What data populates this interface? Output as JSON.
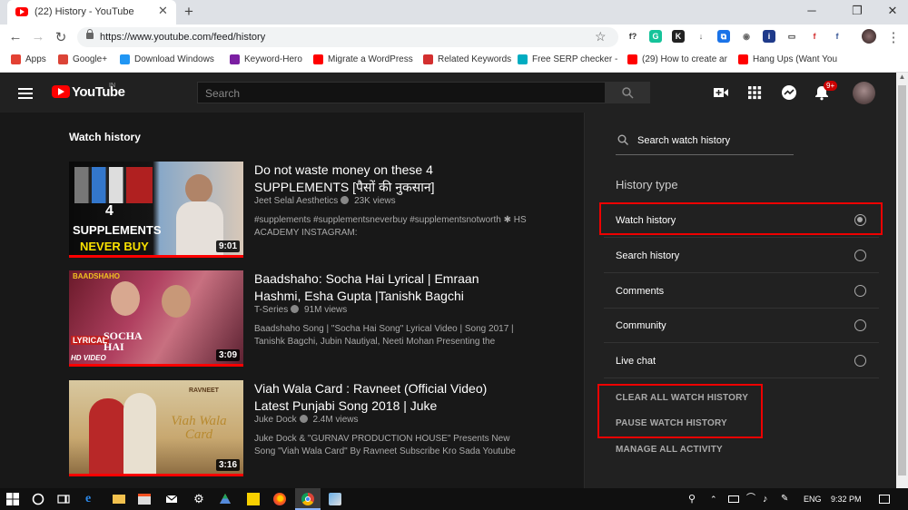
{
  "browser": {
    "tab_title": "(22) History - YouTube",
    "tab_close": "✕",
    "new_tab": "+",
    "window_minimize": "─",
    "window_restore": "❐",
    "window_close": "✕",
    "url": "https://www.youtube.com/feed/history",
    "nav_back": "←",
    "nav_forward": "→",
    "nav_reload": "↻",
    "star": "☆",
    "menu_dots": "⋮"
  },
  "extensions": [
    {
      "label": "f?",
      "color": "#ffffff",
      "text_color": "#333333"
    },
    {
      "label": "G",
      "color": "#15c39a",
      "text_color": "#ffffff"
    },
    {
      "label": "K",
      "color": "#222222",
      "text_color": "#ffffff"
    },
    {
      "label": "↓",
      "color": "#ffffff",
      "text_color": "#555555"
    },
    {
      "label": "⧉",
      "color": "#1a73e8",
      "text_color": "#ffffff"
    },
    {
      "label": "◉",
      "color": "#ffffff",
      "text_color": "#666666"
    },
    {
      "label": "i",
      "color": "#1f3a8a",
      "text_color": "#ffffff"
    },
    {
      "label": "▭",
      "color": "#ffffff",
      "text_color": "#333333"
    },
    {
      "label": "f",
      "color": "#ffffff",
      "text_color": "#d32f2f"
    },
    {
      "label": "f",
      "color": "#ffffff",
      "text_color": "#3b5998"
    }
  ],
  "bookmarks": [
    {
      "label": "Apps",
      "color": "#e34133"
    },
    {
      "label": "Google+",
      "color": "#db4437"
    },
    {
      "label": "Download Windows",
      "color": "#2196f3"
    },
    {
      "label": "Keyword-Hero",
      "color": "#7b1fa2"
    },
    {
      "label": "Migrate a WordPress",
      "color": "#ff0000"
    },
    {
      "label": "Related Keywords",
      "color": "#d32f2f"
    },
    {
      "label": "Free SERP checker -",
      "color": "#00acc1"
    },
    {
      "label": "(29) How to create ar",
      "color": "#ff0000"
    },
    {
      "label": "Hang Ups (Want You",
      "color": "#ff0000"
    }
  ],
  "youtube": {
    "logo_text": "YouTube",
    "logo_country": "IN",
    "search_placeholder": "Search",
    "notifications_badge": "9+"
  },
  "main": {
    "title": "Watch history",
    "videos": [
      {
        "title": "Do not waste money on these 4 SUPPLEMENTS [पैसों की नुकसान]",
        "channel": "Jeet Selal Aesthetics",
        "views": "23K views",
        "description": "#supplements #supplementsneverbuy #supplementsnotworth ✱ HS ACADEMY INSTAGRAM:",
        "duration": "9:01",
        "thumb_text_1": "4",
        "thumb_text_2": "SUPPLEMENTS",
        "thumb_text_3": "NEVER BUY",
        "progress": 1.0
      },
      {
        "title": "Baadshaho: Socha Hai Lyrical | Emraan Hashmi, Esha Gupta |Tanishk Bagchi",
        "channel": "T-Series",
        "views": "91M views",
        "description": "Baadshaho Song | \"Socha Hai Song\" Lyrical Video | Song 2017 | Tanishk Bagchi, Jubin Nautiyal, Neeti Mohan Presenting the",
        "duration": "3:09",
        "thumb_text_1": "BAADSHAHO",
        "thumb_text_2": "LYRICAL",
        "thumb_text_3": "SOCHA HAI",
        "thumb_text_4": "HD VIDEO",
        "progress": 1.0
      },
      {
        "title": "Viah Wala Card : Ravneet (Official Video) Latest Punjabi Song 2018 | Juke",
        "channel": "Juke Dock",
        "views": "2.4M views",
        "description": "Juke Dock & \"GURNAV PRODUCTION HOUSE\" Presents New Song \"Viah Wala Card\" By Ravneet Subscribe Kro Sada Youtube",
        "duration": "3:16",
        "thumb_text_1": "RAVNEET",
        "thumb_text_2": "Viah Wala Card",
        "progress": 1.0
      }
    ]
  },
  "side": {
    "search_placeholder": "Search watch history",
    "history_type_label": "History type",
    "options": [
      {
        "label": "Watch history",
        "selected": true
      },
      {
        "label": "Search history",
        "selected": false
      },
      {
        "label": "Comments",
        "selected": false
      },
      {
        "label": "Community",
        "selected": false
      },
      {
        "label": "Live chat",
        "selected": false
      }
    ],
    "actions": [
      "CLEAR ALL WATCH HISTORY",
      "PAUSE WATCH HISTORY",
      "MANAGE ALL ACTIVITY"
    ]
  },
  "taskbar": {
    "language": "ENG",
    "time": "9:32 PM"
  }
}
